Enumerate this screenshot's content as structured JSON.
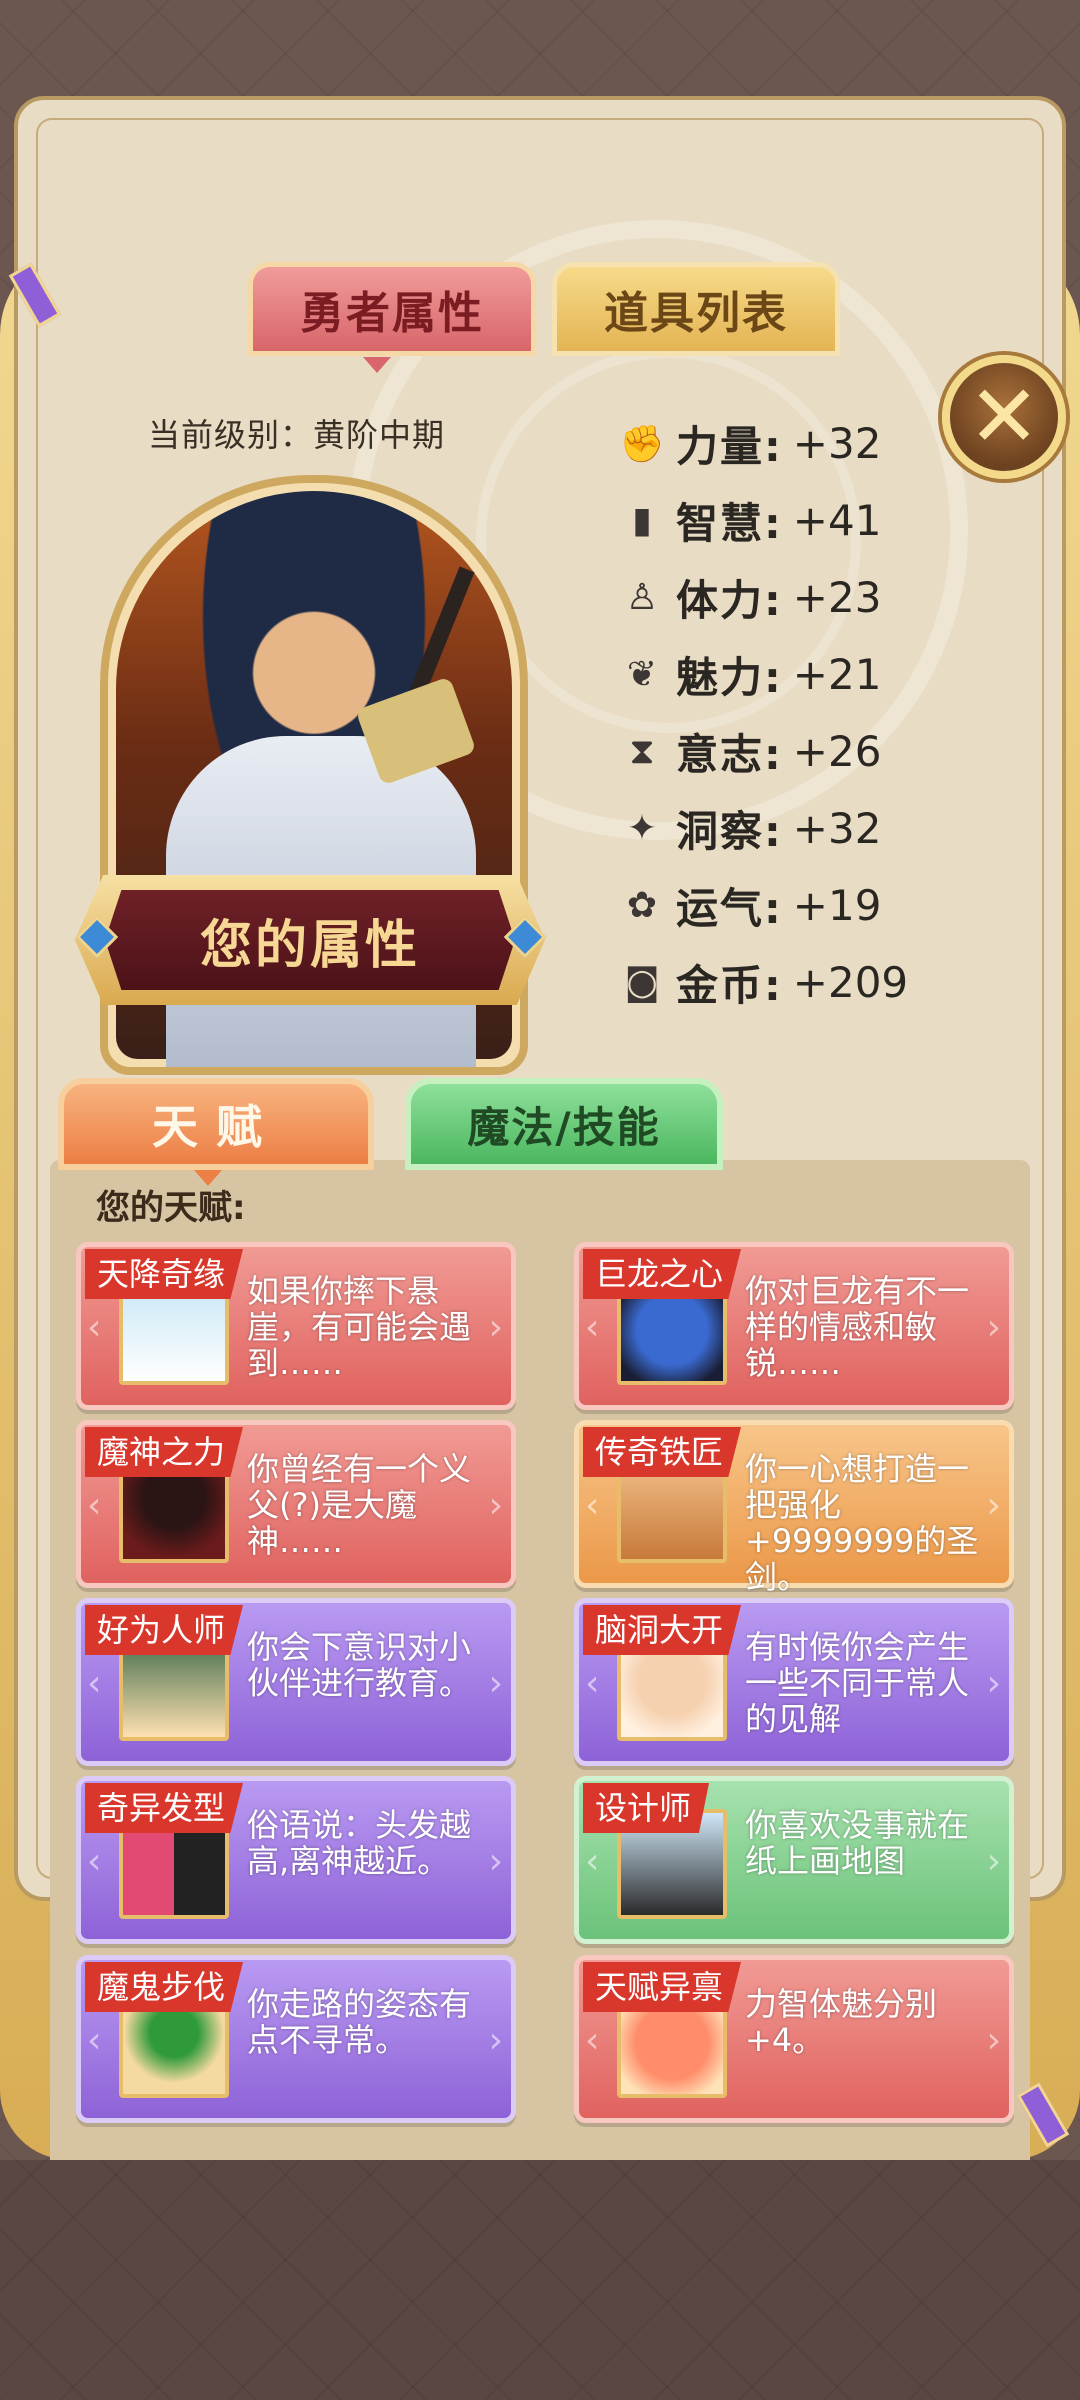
{
  "tabs": {
    "hero_attributes": "勇者属性",
    "item_list": "道具列表"
  },
  "close_button": "✕",
  "level_text": "当前级别：黄阶中期",
  "portrait_plate": "您的属性",
  "stats": [
    {
      "name": "力量:",
      "value": "+32",
      "icon": "arm-icon"
    },
    {
      "name": "智慧:",
      "value": "+41",
      "icon": "book-icon"
    },
    {
      "name": "体力:",
      "value": "+23",
      "icon": "person-icon"
    },
    {
      "name": "魅力:",
      "value": "+21",
      "icon": "charm-icon"
    },
    {
      "name": "意志:",
      "value": "+26",
      "icon": "hourglass-icon"
    },
    {
      "name": "洞察:",
      "value": "+32",
      "icon": "eagle-icon"
    },
    {
      "name": "运气:",
      "value": "+19",
      "icon": "clover-icon"
    },
    {
      "name": "金币:",
      "value": "+209",
      "icon": "coin-icon"
    }
  ],
  "lower_tabs": {
    "talent": "天赋",
    "magic_skill": "魔法/技能"
  },
  "talent_section_title": "您的天赋:",
  "talents": [
    {
      "name": "天降奇缘",
      "desc": "如果你摔下悬崖，有可能会遇到……",
      "color": "red"
    },
    {
      "name": "巨龙之心",
      "desc": "你对巨龙有不一样的情感和敏锐……",
      "color": "red"
    },
    {
      "name": "魔神之力",
      "desc": "你曾经有一个义父(?)是大魔神……",
      "color": "red"
    },
    {
      "name": "传奇铁匠",
      "desc": "你一心想打造一把强化+9999999的圣剑。",
      "color": "orange"
    },
    {
      "name": "好为人师",
      "desc": "你会下意识对小伙伴进行教育。",
      "color": "purple"
    },
    {
      "name": "脑洞大开",
      "desc": "有时候你会产生一些不同于常人的见解",
      "color": "purple"
    },
    {
      "name": "奇异发型",
      "desc": "俗语说：头发越高,离神越近。",
      "color": "purple"
    },
    {
      "name": "设计师",
      "desc": "你喜欢没事就在纸上画地图",
      "color": "green"
    },
    {
      "name": "魔鬼步伐",
      "desc": "你走路的姿态有点不寻常。",
      "color": "purple"
    },
    {
      "name": "天赋异禀",
      "desc": "力智体魅分别+4。",
      "color": "red"
    }
  ],
  "colors": {
    "panel_gold": "#d8ad55",
    "panel_bg": "#e8dcc4",
    "tab_red": "#d8666a",
    "tab_gold": "#e3b453",
    "tab_orange": "#ec7f45",
    "tab_green": "#4bb75f"
  }
}
